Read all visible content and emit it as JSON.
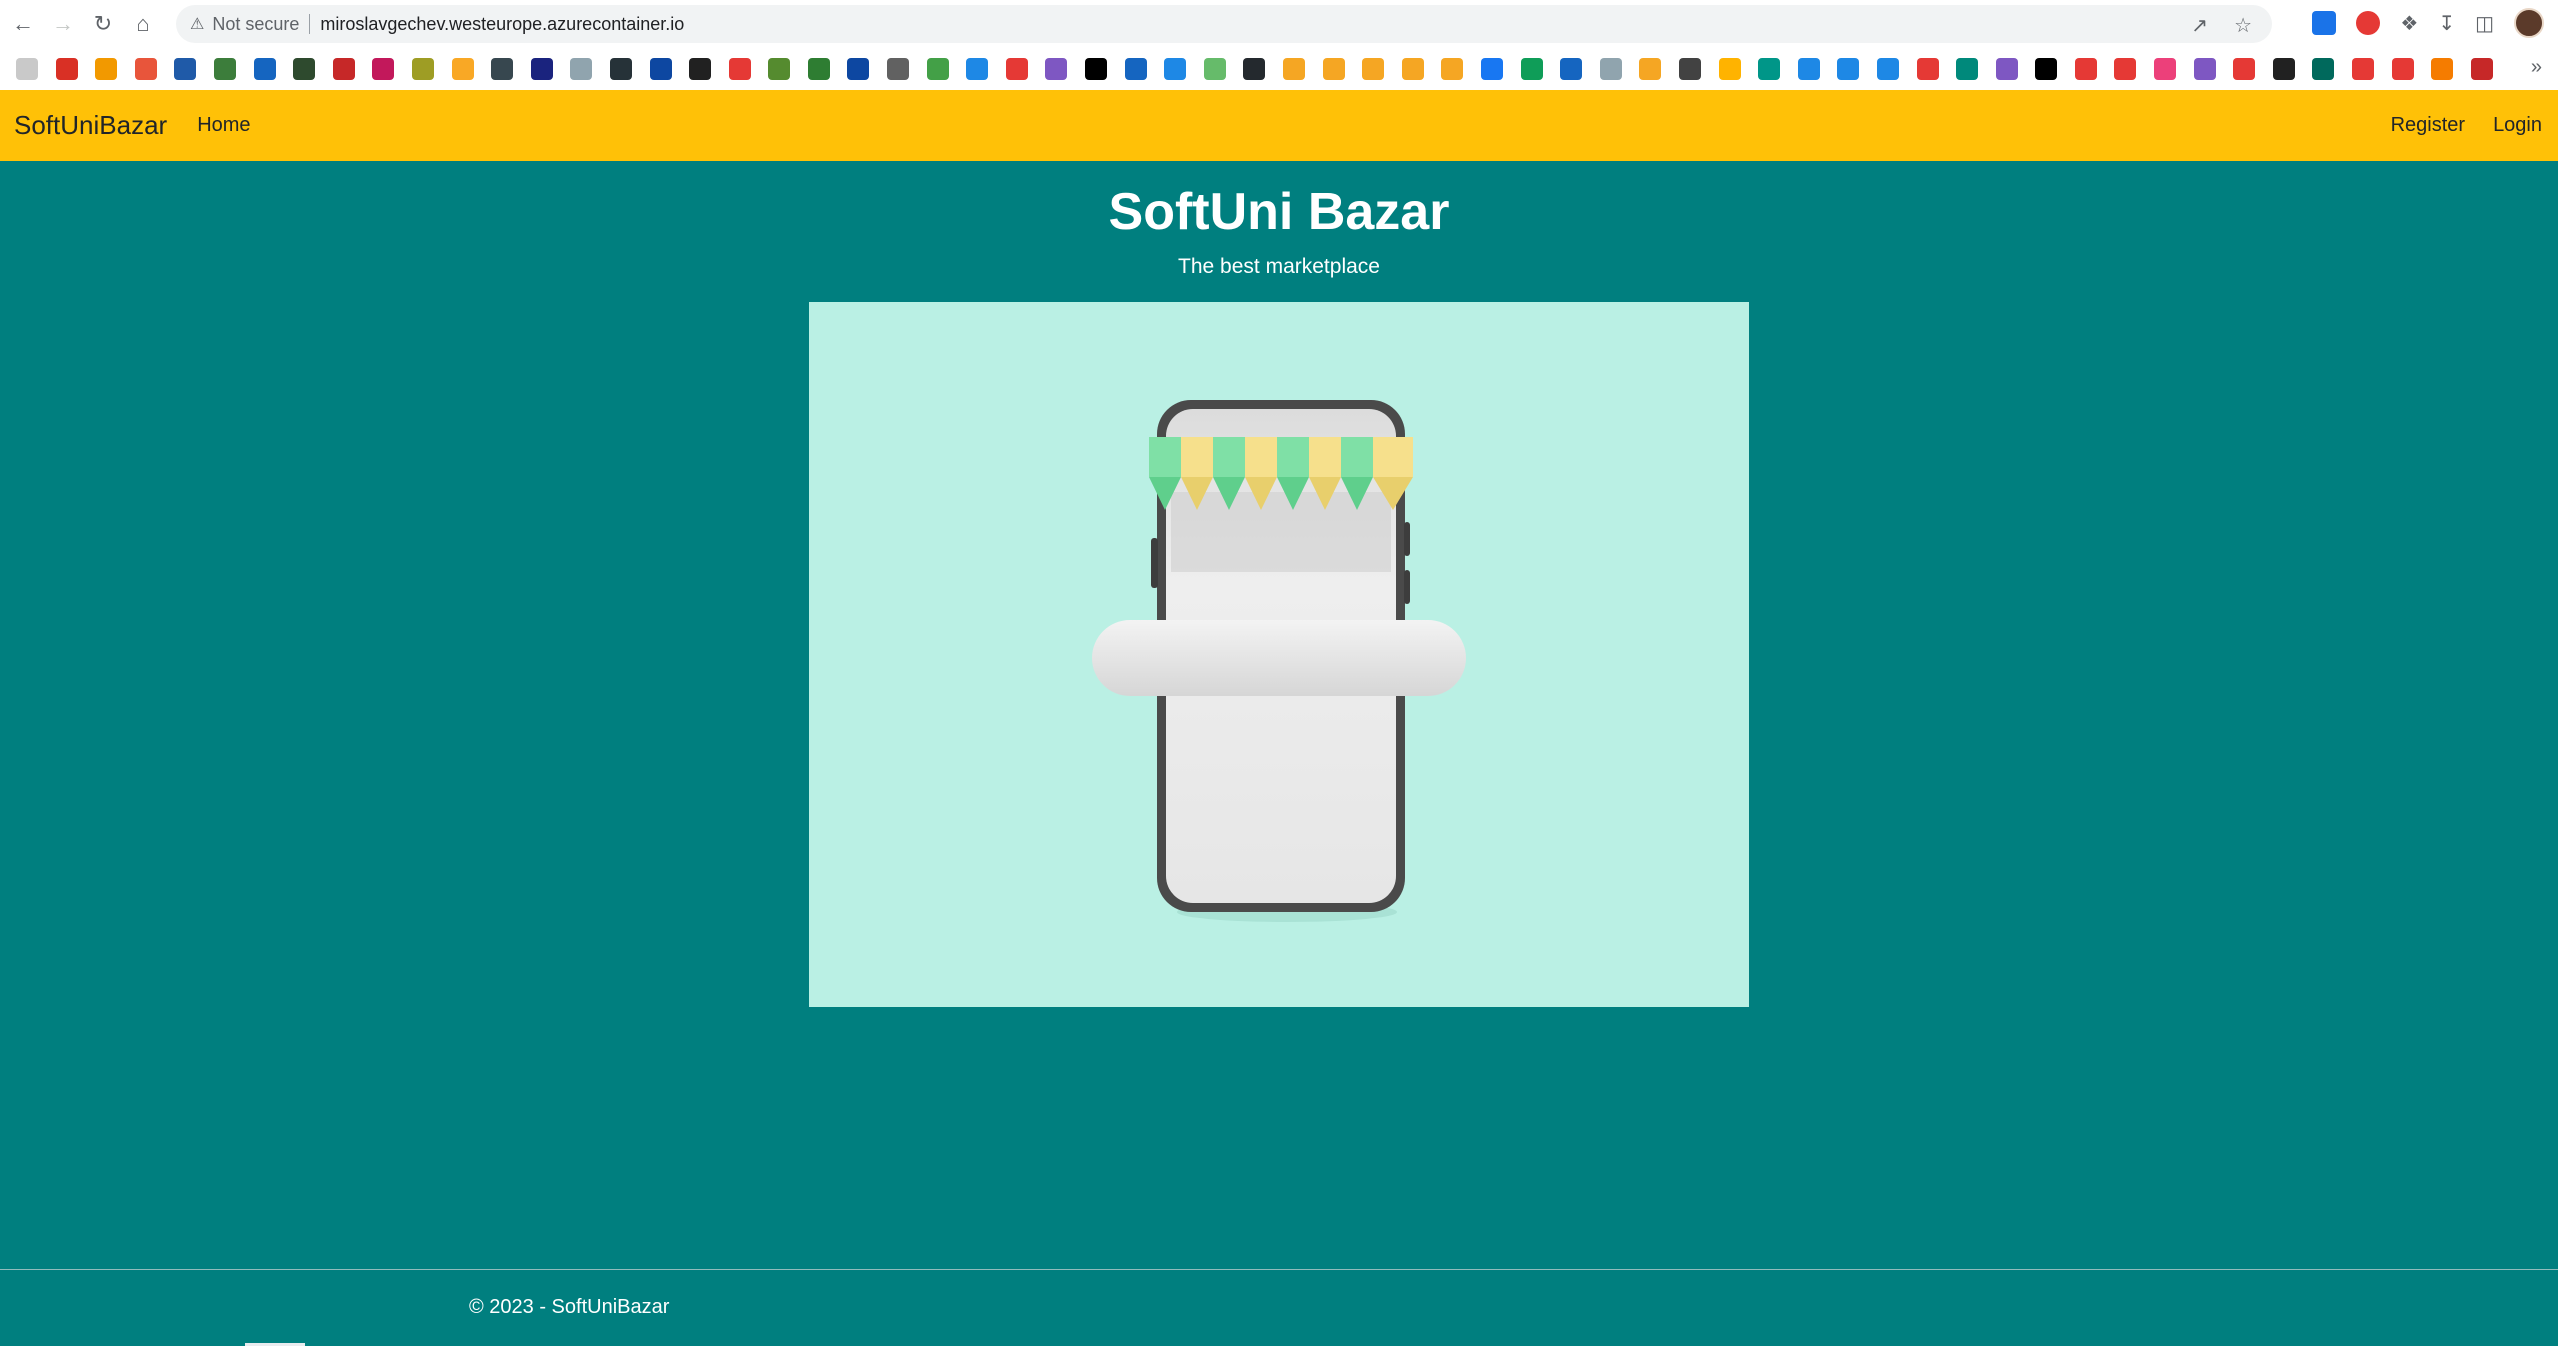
{
  "browser": {
    "security_label": "Not secure",
    "url": "miroslavgechev.westeurope.azurecontainer.io",
    "bookmark_count": 63
  },
  "navbar": {
    "brand": "SoftUniBazar",
    "links": [
      "Home"
    ],
    "right_links": [
      "Register",
      "Login"
    ],
    "background": "#ffc107"
  },
  "main": {
    "title": "SoftUni Bazar",
    "subtitle": "The best marketplace",
    "background": "#007f7f",
    "image_background": "#baf0e4"
  },
  "footer": {
    "text": "© 2023 - SoftUniBazar"
  }
}
